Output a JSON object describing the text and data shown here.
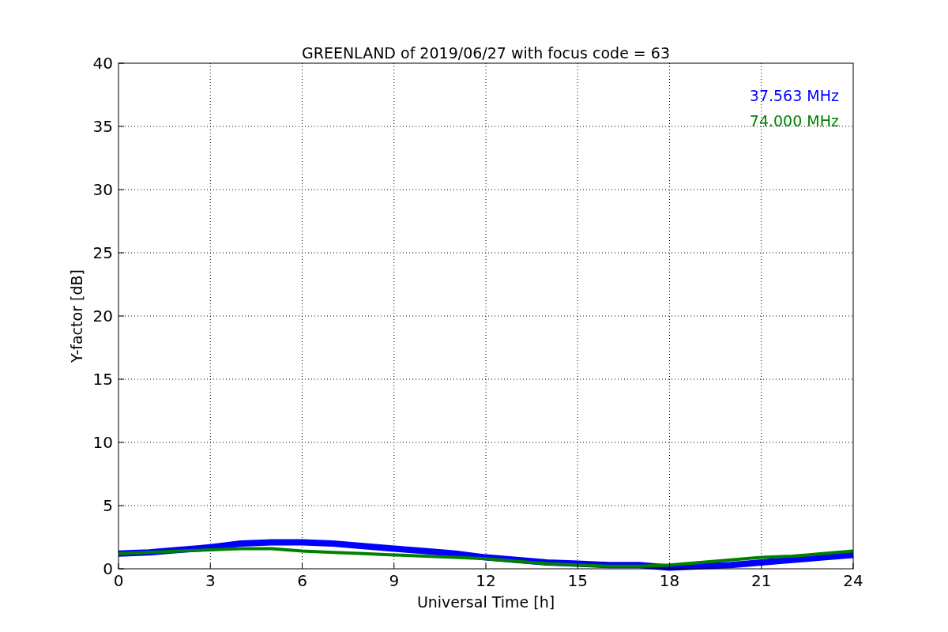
{
  "figure": {
    "chart_data": {
      "type": "line",
      "title": "GREENLAND of 2019/06/27 with focus code = 63",
      "xlabel": "Universal Time [h]",
      "ylabel": "Y-factor [dB]",
      "x": [
        0,
        1,
        2,
        3,
        4,
        5,
        6,
        7,
        8,
        9,
        10,
        11,
        12,
        13,
        14,
        15,
        16,
        17,
        18,
        19,
        20,
        21,
        22,
        23,
        24
      ],
      "series": [
        {
          "name": "37.563 MHz",
          "color": "#0000ff",
          "values": [
            1.2,
            1.3,
            1.5,
            1.7,
            2.0,
            2.1,
            2.1,
            2.0,
            1.8,
            1.6,
            1.4,
            1.2,
            0.9,
            0.7,
            0.5,
            0.4,
            0.3,
            0.3,
            0.1,
            0.2,
            0.3,
            0.5,
            0.7,
            0.9,
            1.1
          ]
        },
        {
          "name": "74.000 MHz",
          "color": "#008000",
          "values": [
            1.2,
            1.3,
            1.4,
            1.5,
            1.6,
            1.6,
            1.4,
            1.3,
            1.2,
            1.1,
            1.0,
            0.9,
            0.8,
            0.6,
            0.4,
            0.3,
            0.2,
            0.2,
            0.3,
            0.5,
            0.7,
            0.9,
            1.0,
            1.2,
            1.4
          ]
        }
      ],
      "xlim": [
        0,
        24
      ],
      "ylim": [
        0,
        40
      ],
      "xticks": [
        0,
        3,
        6,
        9,
        12,
        15,
        18,
        21,
        24
      ],
      "yticks": [
        0,
        5,
        10,
        15,
        20,
        25,
        30,
        35,
        40
      ],
      "grid": true
    }
  }
}
